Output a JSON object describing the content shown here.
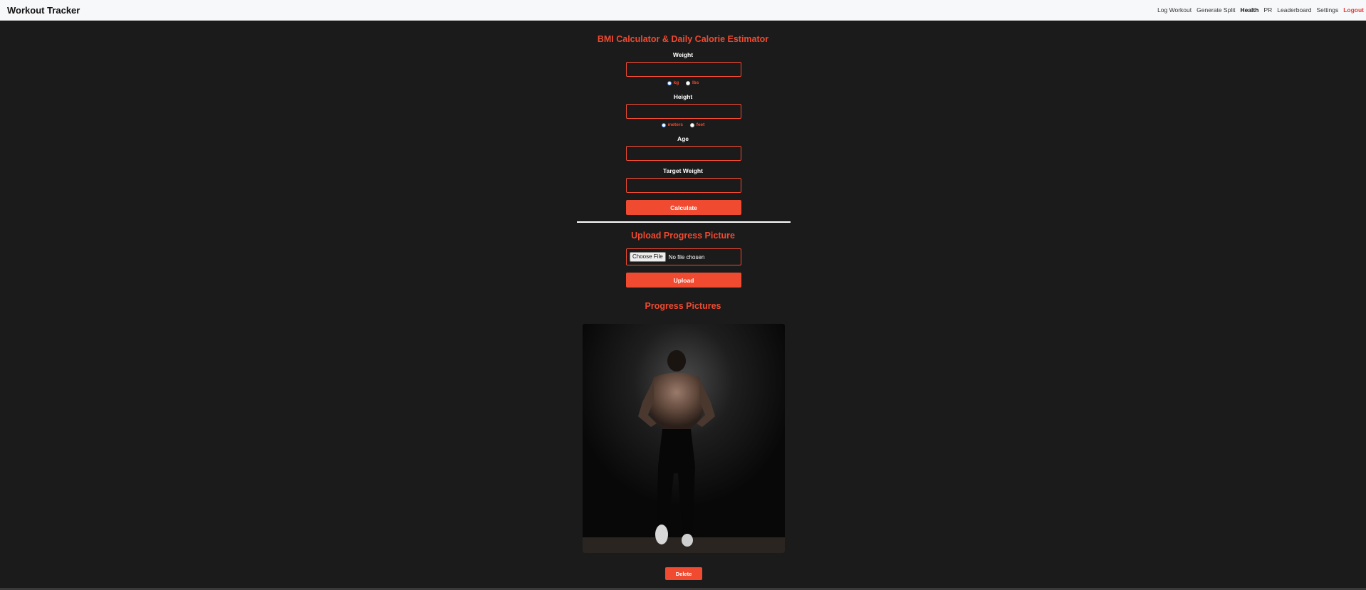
{
  "app": {
    "title": "Workout Tracker"
  },
  "nav": {
    "items": [
      "Log Workout",
      "Generate Split",
      "Health",
      "PR",
      "Leaderboard",
      "Settings"
    ],
    "active": "Health",
    "logout": "Logout"
  },
  "bmi": {
    "title": "BMI Calculator & Daily Calorie Estimator",
    "weight_label": "Weight",
    "weight_units": [
      "kg",
      "lbs"
    ],
    "weight_unit_selected": "kg",
    "height_label": "Height",
    "height_units": [
      "meters",
      "feet"
    ],
    "height_unit_selected": "meters",
    "age_label": "Age",
    "target_label": "Target Weight",
    "calculate_label": "Calculate"
  },
  "upload": {
    "title": "Upload Progress Picture",
    "choose_label": "Choose File",
    "no_file_text": "No file chosen",
    "upload_label": "Upload"
  },
  "gallery": {
    "title": "Progress Pictures",
    "delete_label": "Delete"
  },
  "colors": {
    "accent": "#f04a30",
    "background": "#1b1b1b",
    "topbar": "#f7f8fa",
    "logout": "#e53935"
  }
}
